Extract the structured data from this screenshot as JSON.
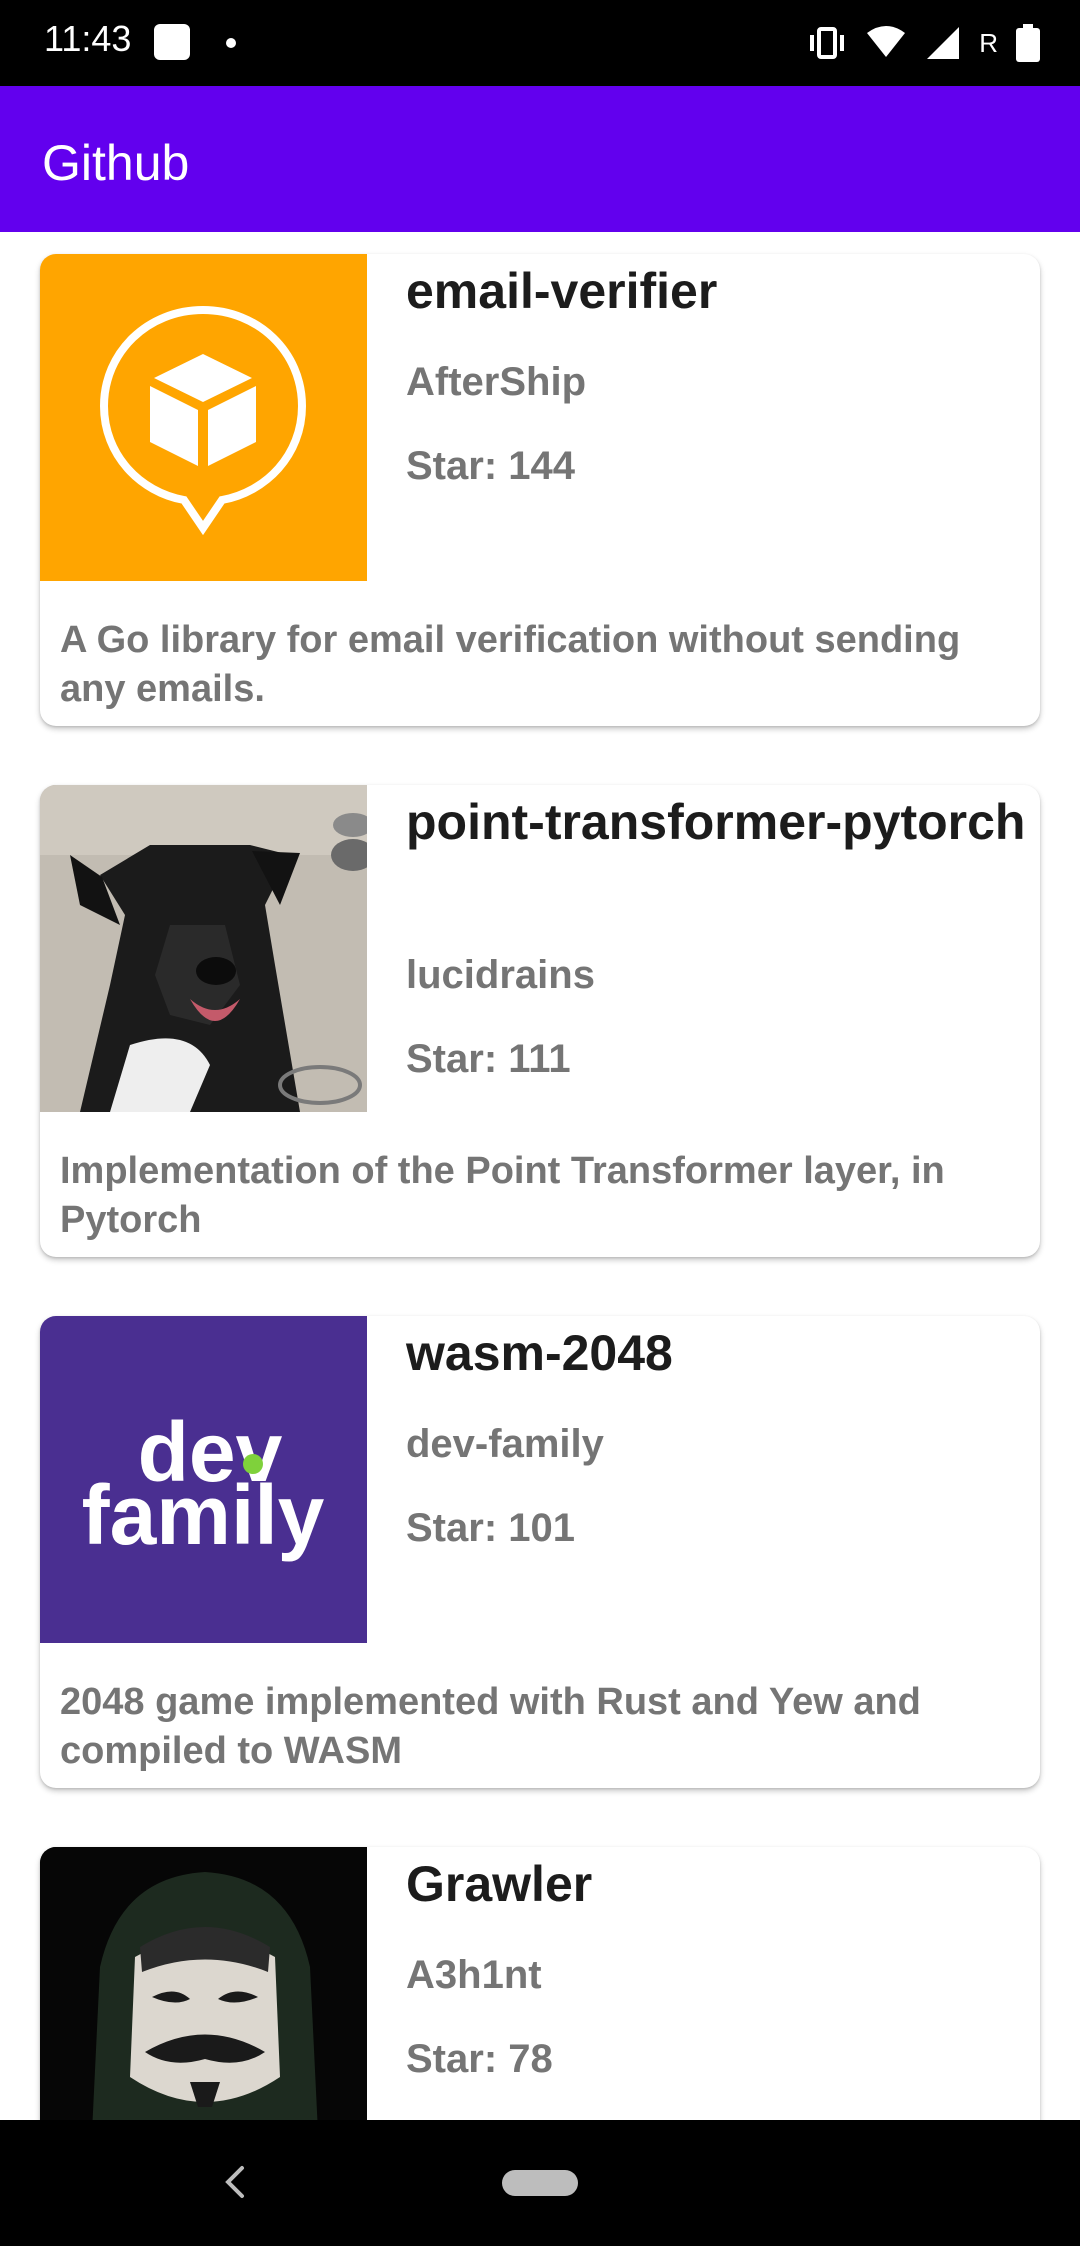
{
  "status_bar": {
    "time": "11:43",
    "carrier_badge": "R"
  },
  "app_bar": {
    "title": "Github"
  },
  "repos": [
    {
      "name": "email-verifier",
      "owner": "AfterShip",
      "stars": "Star: 144",
      "description": "A Go library for email verification without sending any emails.",
      "avatar": "aftership-logo",
      "avatar_color": "#ffa500"
    },
    {
      "name": "point-transformer-pytorch",
      "owner": "lucidrains",
      "stars": "Star: 111",
      "description": "Implementation of the Point Transformer layer, in Pytorch",
      "avatar": "dog-photo"
    },
    {
      "name": "wasm-2048",
      "owner": "dev-family",
      "stars": "Star: 101",
      "description": "2048 game implemented with Rust and Yew and compiled to WASM",
      "avatar": "dev-family-logo",
      "avatar_color": "#4a2f91",
      "logo_text_line1": "dev",
      "logo_text_line2": "family"
    },
    {
      "name": "Grawler",
      "owner": "A3h1nt",
      "stars": "Star: 78",
      "description": "",
      "avatar": "masked-hacker-photo"
    }
  ],
  "colors": {
    "primary": "#6200ee",
    "secondary_text": "#757575"
  }
}
